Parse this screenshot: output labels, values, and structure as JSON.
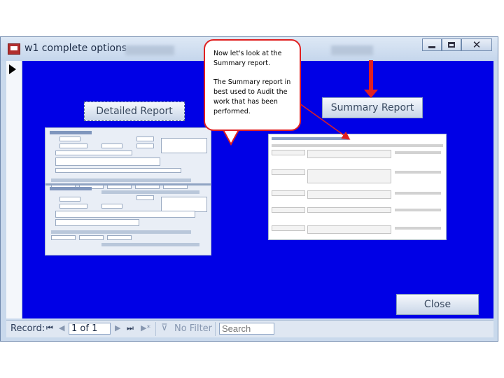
{
  "window": {
    "title": "w1 complete options"
  },
  "buttons": {
    "detailed_report": "Detailed Report",
    "summary_report": "Summary Report",
    "close": "Close"
  },
  "record_nav": {
    "label": "Record:",
    "current": "1 of 1",
    "filter_status": "No Filter",
    "search_placeholder": "Search"
  },
  "callout": {
    "line1": "Now let's look at the Summary report.",
    "line2": "The Summary report in best used to Audit the work that has been performed."
  },
  "colors": {
    "form_background": "#0000e6",
    "annotation_red": "#e02020",
    "titlebar": "#c9d9ec"
  },
  "icons": [
    "app-icon",
    "minimize-icon",
    "maximize-icon",
    "close-icon",
    "record-selector-arrow-icon",
    "first-record-icon",
    "previous-record-icon",
    "next-record-icon",
    "last-record-icon",
    "new-record-icon",
    "filter-icon"
  ]
}
